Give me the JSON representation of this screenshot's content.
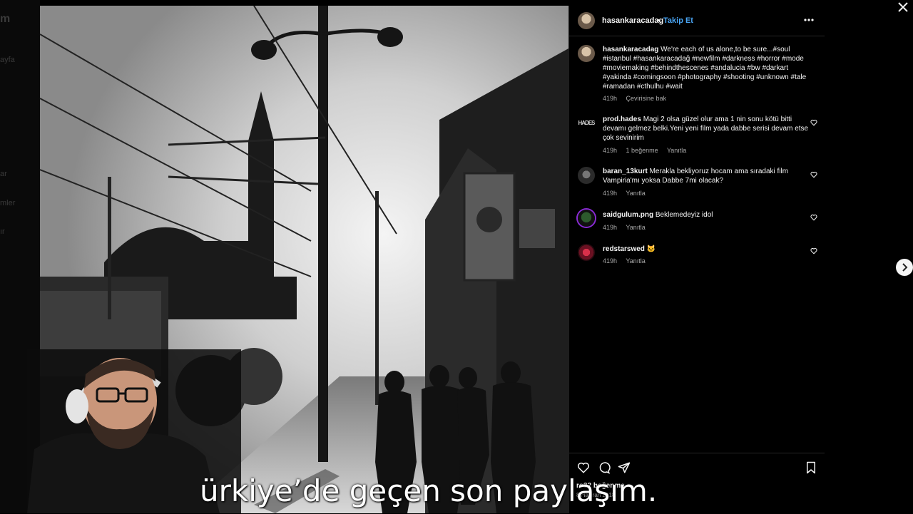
{
  "background": {
    "logo_fragment": "m",
    "sidebar_fragments": [
      "ayfa",
      "ar",
      "mler",
      "ır"
    ]
  },
  "post": {
    "author": "hasankaracadag",
    "follow_label": "Takip Et",
    "separator": "•",
    "caption_author": "hasankaracadag",
    "caption_text": "We're each of us alone,to be sure...#soul #istanbul #hasankaracadağ #newfilm #darkness #horror #mode #moviemaking #behindthescenes #andalucia #bw #darkart #yakinda #comingsoon #photography #shooting #unknown #tale #ramadan #cthulhu #wait",
    "caption_time": "419h",
    "translate_label": "Çevirisine bak"
  },
  "comments": [
    {
      "user": "prod.hades",
      "text": "Magi 2 olsa güzel olur ama 1 nin sonu kötü bitti devamı gelmez belki.Yeni yeni film yada dabbe serisi devam etse çok sevinirim",
      "time": "419h",
      "likes": "1 beğenme",
      "reply": "Yanıtla"
    },
    {
      "user": "baran_13kurt",
      "text": "Merakla bekliyoruz hocam ama sıradaki film Vampiria'mı yoksa Dabbe 7mi olacak?",
      "time": "419h",
      "reply": "Yanıtla"
    },
    {
      "user": "saidgulum.png",
      "text": "Beklemedeyiz idol",
      "time": "419h",
      "reply": "Yanıtla"
    },
    {
      "user": "redstarswed",
      "text": "🐱",
      "time": "419h",
      "reply": "Yanıtla"
    }
  ],
  "footer": {
    "likes": "ro32 beğenme",
    "date": "8 Haziran 2018"
  },
  "subtitle": "ürkiye’de geçen son paylaşım.",
  "icons": [
    "more-icon",
    "heart-icon",
    "comment-icon",
    "share-icon",
    "bookmark-icon",
    "close-icon",
    "chevron-right-icon"
  ],
  "colors": {
    "accent": "#4aa6f5",
    "panel_bg": "#000000",
    "muted": "#a8a8a8"
  }
}
